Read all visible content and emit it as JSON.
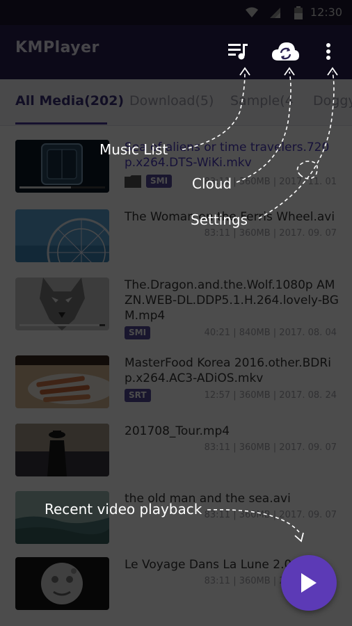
{
  "status": {
    "time": "12:30"
  },
  "app": {
    "title": "KMPlayer"
  },
  "toolbar": {
    "music_list_icon": "playlist-music-icon",
    "cloud_icon": "cloud-sync-icon",
    "menu_icon": "more-vert-icon"
  },
  "tabs": [
    {
      "label": "All Media(202)",
      "active": true
    },
    {
      "label": "Download(5)",
      "active": false
    },
    {
      "label": "Sample(4",
      "active": false
    },
    {
      "label": "Doggy",
      "active": false
    }
  ],
  "items": [
    {
      "title": "Sea of aliens or time travelers.720p.x264.DTS-WiKi.mkv",
      "meta": "83:11 | 360MB | 2017. 11. 01",
      "badge": "SMI",
      "progress": 0.6,
      "has_folder": true
    },
    {
      "title": "The Woman on the Ferris Wheel.avi",
      "meta": "83:11 | 360MB | 2017. 09. 07",
      "badge": ""
    },
    {
      "title": "The.Dragon.and.the.Wolf.1080p AMZN.WEB-DL.DDP5.1.H.264.lovely-BGM.mp4",
      "meta": "40:21 | 840MB | 2017. 08. 04",
      "badge": "SMI",
      "progress": 0.9
    },
    {
      "title": "MasterFood Korea 2016.other.BDRip.x264.AC3-ADiOS.mkv",
      "meta": "12:57 | 360MB | 2017. 08. 24",
      "badge": "SRT"
    },
    {
      "title": "201708_Tour.mp4",
      "meta": "83:11 | 360MB | 2017. 09. 07",
      "badge": ""
    },
    {
      "title": "the old man and the sea.avi",
      "meta": "83:11 | 360MB | 2017. 09. 07",
      "badge": ""
    },
    {
      "title": "Le Voyage Dans La Lune 2.0.mp4",
      "meta": "83:11 | 360MB | 2017. 09. 07",
      "badge": ""
    }
  ],
  "tooltips": {
    "music_list": "Music List",
    "cloud": "Cloud",
    "settings": "Settings",
    "recent": "Recent video playback"
  },
  "colors": {
    "accent": "#5c3ab6",
    "appbar": "#2a2150",
    "badge": "#544a9a"
  }
}
